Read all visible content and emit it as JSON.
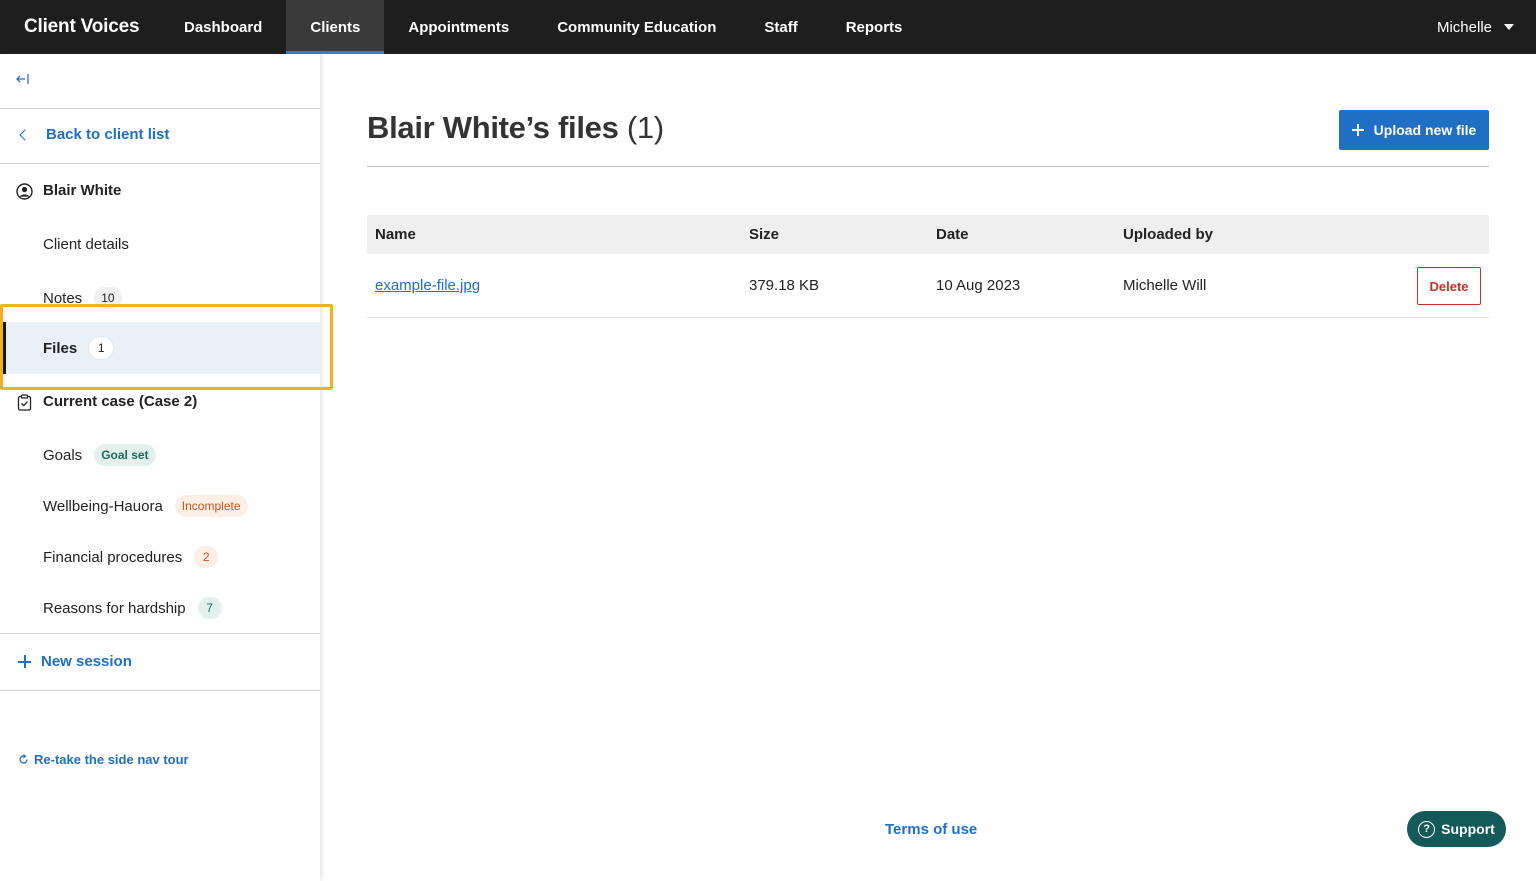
{
  "app": {
    "brand": "Client Voices"
  },
  "nav": {
    "items": [
      {
        "label": "Dashboard"
      },
      {
        "label": "Clients",
        "active": true
      },
      {
        "label": "Appointments"
      },
      {
        "label": "Community Education"
      },
      {
        "label": "Staff"
      },
      {
        "label": "Reports"
      }
    ],
    "user": "Michelle"
  },
  "sidebar": {
    "collapse_icon": "collapse-left-icon",
    "back_label": "Back to client list",
    "client_name": "Blair White",
    "client_details": "Client details",
    "notes": {
      "label": "Notes",
      "count": "10"
    },
    "files": {
      "label": "Files",
      "count": "1"
    },
    "current_case": "Current case (Case 2)",
    "goals": {
      "label": "Goals",
      "badge": "Goal set"
    },
    "wellbeing": {
      "label": "Wellbeing-Hauora",
      "badge": "Incomplete"
    },
    "financial": {
      "label": "Financial procedures",
      "count": "2"
    },
    "hardship": {
      "label": "Reasons for hardship",
      "count": "7"
    },
    "new_session": "New session",
    "retake_tour": "Re-take the side nav tour"
  },
  "main": {
    "title": "Blair White’s files",
    "title_count": "(1)",
    "upload_label": "Upload new file",
    "table": {
      "headers": [
        "Name",
        "Size",
        "Date",
        "Uploaded by"
      ],
      "rows": [
        {
          "name": "example-file.jpg",
          "size": "379.18 KB",
          "date": "10 Aug 2023",
          "uploaded_by": "Michelle Will",
          "action": "Delete"
        }
      ]
    }
  },
  "footer": {
    "terms": "Terms of use",
    "support": "Support"
  },
  "colors": {
    "accent": "#1f6fc5",
    "highlight": "#f2b126",
    "danger": "#c9302c",
    "support": "#145a5a"
  }
}
